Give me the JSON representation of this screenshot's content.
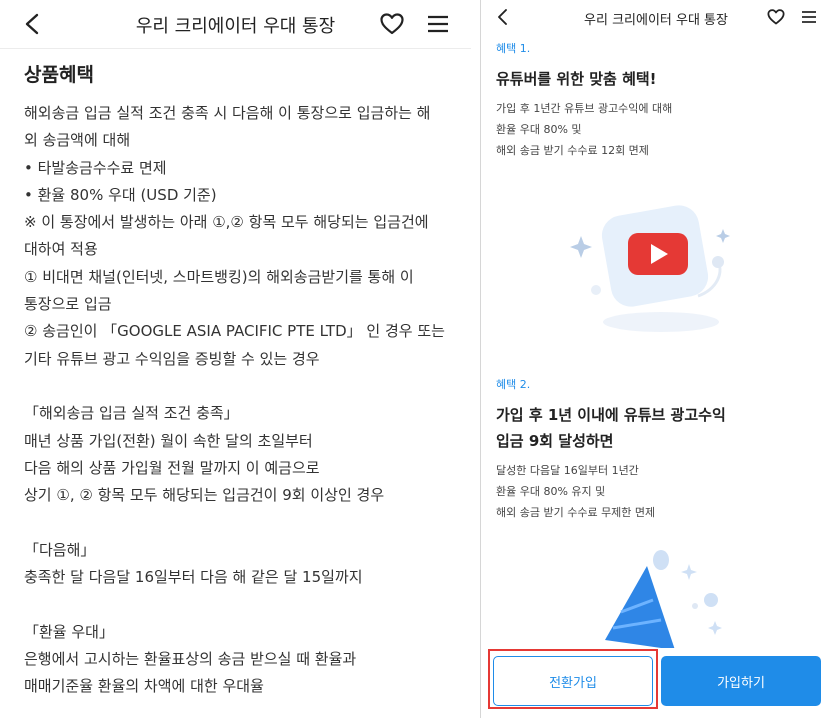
{
  "left": {
    "header": {
      "title": "우리 크리에이터 우대 통장"
    },
    "section_title": "상품혜택",
    "lines": [
      "해외송금 입금 실적 조건 충족 시 다음해 이 통장으로 입금하는 해",
      "외 송금액에 대해",
      "• 타발송금수수료 면제",
      "• 환율 80% 우대 (USD 기준)",
      "※ 이 통장에서 발생하는 아래 ①,② 항목 모두 해당되는 입금건에",
      "대하여 적용",
      "① 비대면 채널(인터넷, 스마트뱅킹)의 해외송금받기를 통해 이",
      "통장으로 입금",
      "② 송금인이 「GOOGLE ASIA PACIFIC PTE LTD」 인 경우 또는",
      "기타 유튜브 광고 수익임을 증빙할 수 있는 경우",
      "",
      "「해외송금 입금 실적 조건 충족」",
      "매년 상품 가입(전환) 월이 속한 달의 초일부터",
      "다음 해의 상품 가입월 전월 말까지 이 예금으로",
      "상기 ①, ② 항목 모두 해당되는 입금건이 9회 이상인 경우",
      "",
      "「다음해」",
      "충족한 달 다음달 16일부터 다음 해 같은 달 15일까지",
      "",
      "「환율 우대」",
      "은행에서 고시하는 환율표상의 송금 받으실 때 환율과",
      "매매기준율 환율의 차액에 대한 우대율"
    ]
  },
  "right": {
    "header": {
      "title": "우리 크리에이터 우대 통장"
    },
    "benefit1": {
      "tag": "혜택 1.",
      "title": "유튜버를 위한 맞춤 혜택!",
      "desc": [
        "가입 후 1년간 유튜브 광고수익에 대해",
        "환율 우대 80% 및",
        "해외 송금 받기 수수료 12회 면제"
      ]
    },
    "benefit2": {
      "tag": "혜택 2.",
      "title_lines": [
        "가입 후 1년 이내에 유튜브 광고수익",
        "입금 9회 달성하면"
      ],
      "desc": [
        "달성한 다음달 16일부터 1년간",
        "환율 우대 80% 유지 및",
        "해외 송금 받기 수수료 무제한 면제"
      ]
    },
    "buttons": {
      "convert": "전환가입",
      "join": "가입하기"
    }
  },
  "colors": {
    "accent": "#1f8ce8",
    "highlight": "#e53935",
    "youtube_red": "#e53935"
  },
  "icons": [
    "back-icon",
    "heart-icon",
    "menu-icon",
    "youtube-illustration",
    "party-hat-illustration"
  ]
}
